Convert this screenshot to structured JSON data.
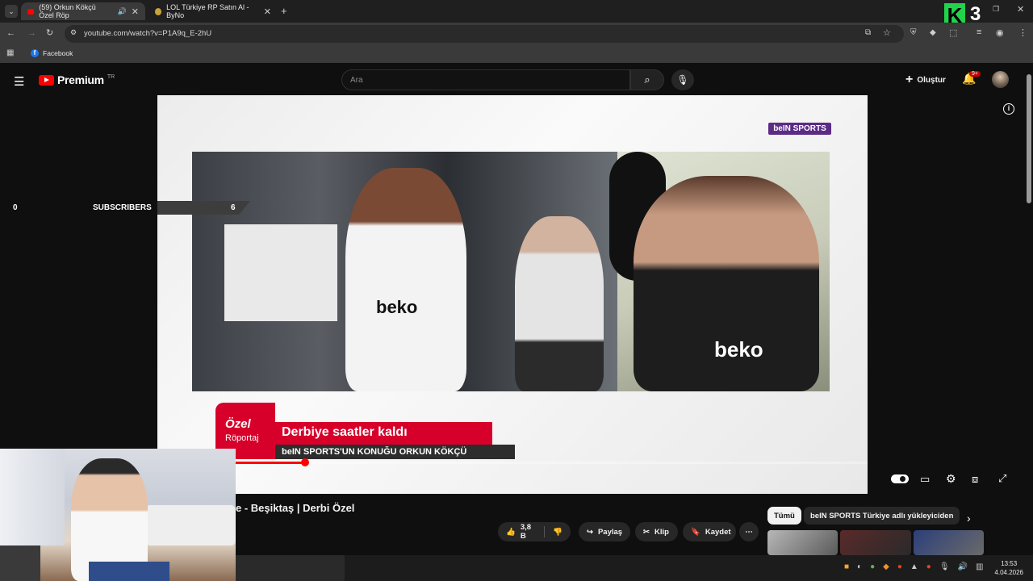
{
  "browser": {
    "tabs": [
      {
        "title": "(59) Orkun Kökçü Özel Röp",
        "active": true
      },
      {
        "title": "LOL Türkiye RP Satın Al - ByNo",
        "active": false
      }
    ],
    "url": "youtube.com/watch?v=P1A9q_E-2hU",
    "bookmarks": [
      {
        "label": "Facebook"
      }
    ]
  },
  "overlay_logo": {
    "letter": "K",
    "number": "3"
  },
  "youtube": {
    "logo_text": "Premium",
    "country": "TR",
    "search_placeholder": "Ara",
    "create_label": "Oluştur",
    "notif_count": "9+"
  },
  "video_frame": {
    "channel_bug": "beIN SPORTS",
    "lower_third": {
      "badge_top": "Özel",
      "badge_bottom": "Röportaj",
      "headline": "Derbiye saatler kaldı",
      "subline": "beIN SPORTS'UN KONUĞU ORKUN KÖKÇÜ"
    },
    "shirt_text": "beko",
    "progress": 0.11
  },
  "subscribers": {
    "left_value": "0",
    "label": "SUBSCRIBERS",
    "right_value": "6"
  },
  "below": {
    "title": "e - Beşiktaş | Derbi Özel",
    "actions": {
      "likes": "3,8 B",
      "share": "Paylaş",
      "clip": "Klip",
      "save": "Kaydet"
    },
    "chips": [
      "Tümü",
      "beIN SPORTS Türkiye adlı yükleyiciden"
    ]
  },
  "taskbar": {
    "time": "13:53",
    "date": "4.04.2026"
  },
  "colors": {
    "accent": "#ff0000",
    "brand_red": "#d7002a",
    "bein_purple": "#5b2b86"
  }
}
